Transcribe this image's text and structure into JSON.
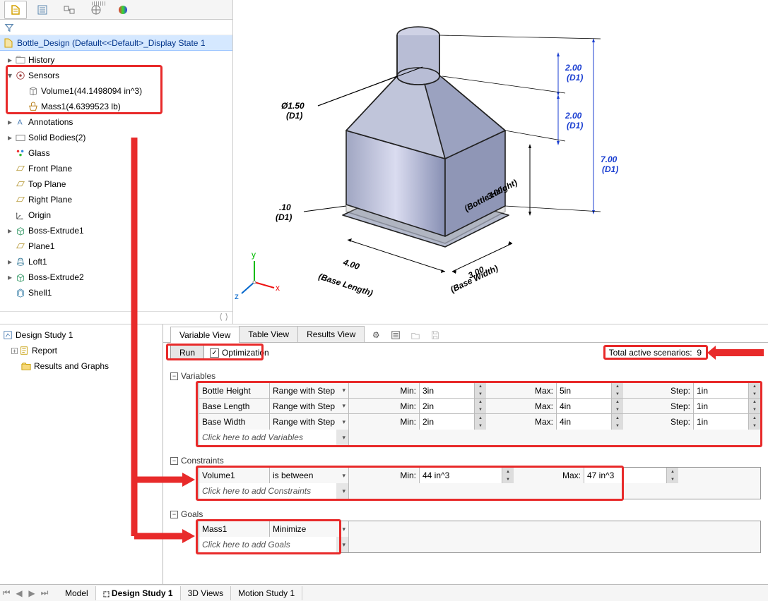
{
  "doc": {
    "name": "Bottle_Design  (Default<<Default>_Display State 1"
  },
  "tree": {
    "history": "History",
    "sensors": "Sensors",
    "sensor_volume": "Volume1(44.1498094 in^3)",
    "sensor_mass": "Mass1(4.6399523 lb)",
    "annotations": "Annotations",
    "solid_bodies": "Solid Bodies(2)",
    "glass": "Glass",
    "front_plane": "Front Plane",
    "top_plane": "Top Plane",
    "right_plane": "Right Plane",
    "origin": "Origin",
    "boss1": "Boss-Extrude1",
    "plane1": "Plane1",
    "loft1": "Loft1",
    "boss2": "Boss-Extrude2",
    "shell1": "Shell1"
  },
  "dims": {
    "neck_dia": "Ø1.50\n(D1)",
    "neck_h": "2.00\n(D1)",
    "shoulder_h": "2.00\n(D1)",
    "total_h": "7.00\n(D1)",
    "body_h": "3.00\n(Bottle Height)",
    "fillet": ".10\n(D1)",
    "base_len": "4.00\n(Base Length)",
    "base_w": "3.00\n(Base Width)"
  },
  "study_tree": {
    "root": "Design Study 1",
    "report": "Report",
    "results": "Results and Graphs"
  },
  "sp": {
    "tab_var": "Variable View",
    "tab_table": "Table View",
    "tab_results": "Results View",
    "run": "Run",
    "opt": "Optimization",
    "scenarios_label": "Total active scenarios:",
    "scenarios_count": "9",
    "sec_vars": "Variables",
    "sec_cons": "Constraints",
    "sec_goals": "Goals",
    "add_vars": "Click here to add Variables",
    "add_cons": "Click here to add Constraints",
    "add_goals": "Click here to add Goals",
    "min": "Min:",
    "max": "Max:",
    "step": "Step:"
  },
  "variables": [
    {
      "name": "Bottle Height",
      "type": "Range with Step",
      "min": "3in",
      "max": "5in",
      "step": "1in"
    },
    {
      "name": "Base Length",
      "type": "Range with Step",
      "min": "2in",
      "max": "4in",
      "step": "1in"
    },
    {
      "name": "Base Width",
      "type": "Range with Step",
      "min": "2in",
      "max": "4in",
      "step": "1in"
    }
  ],
  "constraints": [
    {
      "name": "Volume1",
      "type": "is between",
      "min": "44 in^3",
      "max": "47 in^3"
    }
  ],
  "goals": [
    {
      "name": "Mass1",
      "type": "Minimize"
    }
  ],
  "bottom_tabs": {
    "model": "Model",
    "study": "Design Study 1",
    "views": "3D Views",
    "motion": "Motion Study 1"
  }
}
